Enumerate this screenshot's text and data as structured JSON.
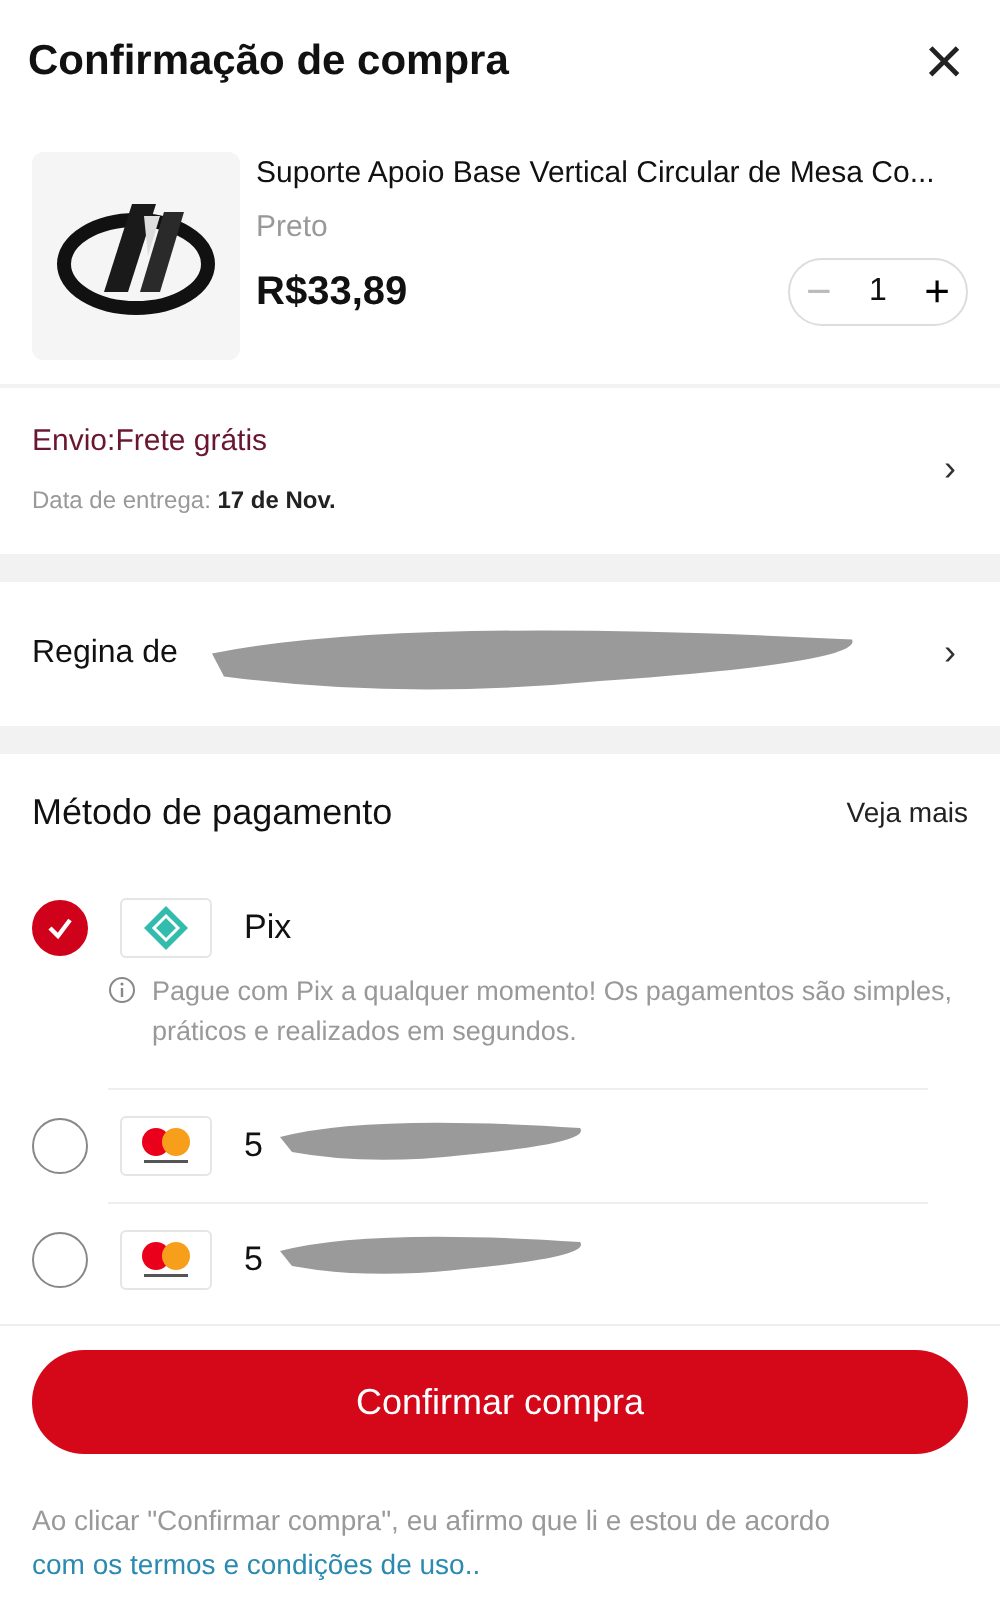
{
  "header": {
    "title": "Confirmação de compra",
    "close": "×"
  },
  "product": {
    "title": "Suporte Apoio Base Vertical Circular de Mesa Co...",
    "variant": "Preto",
    "price": "R$33,89",
    "quantity": "1",
    "minus": "−",
    "plus": "+"
  },
  "shipping": {
    "label": "Envio:Frete grátis",
    "date_label": "Data de entrega: ",
    "date": "17 de Nov.",
    "chevron": "›"
  },
  "address": {
    "text": "Regina de",
    "redacted": true,
    "chevron": "›"
  },
  "payment": {
    "title": "Método de pagamento",
    "more": "Veja mais",
    "methods": [
      {
        "kind": "pix",
        "label": "Pix",
        "selected": true,
        "info": "Pague com Pix a qualquer momento! Os pagamentos são simples, práticos e realizados em segundos."
      },
      {
        "kind": "mastercard",
        "label": "5",
        "selected": false,
        "redacted": true
      },
      {
        "kind": "mastercard",
        "label": "5",
        "selected": false,
        "redacted": true
      }
    ]
  },
  "confirm_button": "Confirmar compra",
  "footer": {
    "text": "Ao clicar \"Confirmar compra\", eu afirmo que li e estou de acordo ",
    "link": "com os termos e condições de uso.."
  }
}
